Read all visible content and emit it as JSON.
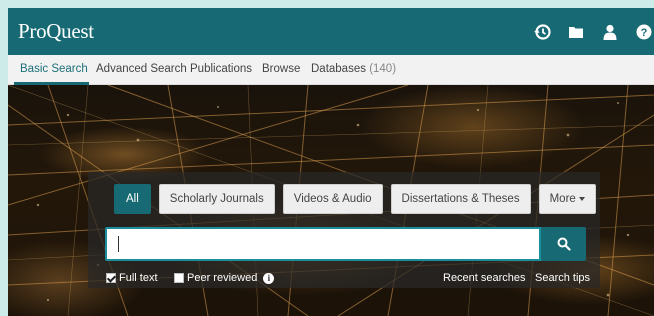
{
  "app": {
    "logo": "ProQuest"
  },
  "header_icons": [
    "history-icon",
    "folder-icon",
    "user-icon",
    "help-icon"
  ],
  "nav": {
    "tabs": [
      {
        "label": "Basic Search",
        "active": true
      },
      {
        "label": "Advanced Search"
      },
      {
        "label": "Publications"
      },
      {
        "label": "Browse"
      },
      {
        "label": "Databases",
        "count": "(140)"
      }
    ]
  },
  "filters": [
    {
      "label": "All",
      "active": true
    },
    {
      "label": "Scholarly Journals"
    },
    {
      "label": "Videos & Audio"
    },
    {
      "label": "Dissertations & Theses"
    },
    {
      "label": "More"
    }
  ],
  "search": {
    "value": "",
    "button_icon": "search-icon"
  },
  "options": {
    "full_text": {
      "label": "Full text",
      "checked": true
    },
    "peer_reviewed": {
      "label": "Peer reviewed",
      "checked": false
    },
    "recent_searches": "Recent searches",
    "search_tips": "Search tips"
  },
  "colors": {
    "brand": "#176a74",
    "accent": "#1a8e9a",
    "nav_bg": "#f2f2f2"
  }
}
